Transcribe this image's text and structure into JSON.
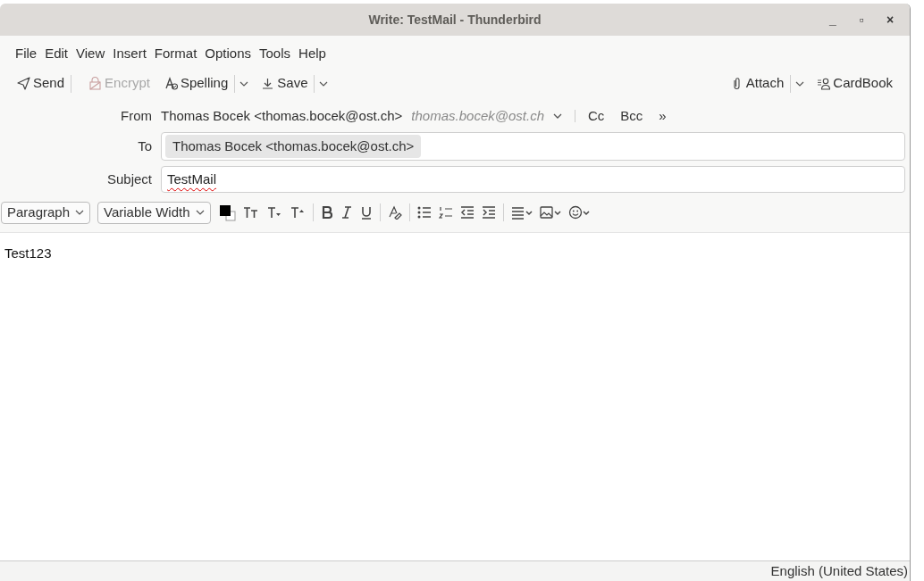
{
  "window": {
    "title": "Write: TestMail - Thunderbird",
    "controls": [
      "_",
      "▫",
      "×"
    ]
  },
  "menu": [
    {
      "label": "File"
    },
    {
      "label": "Edit"
    },
    {
      "label": "View"
    },
    {
      "label": "Insert"
    },
    {
      "label": "Format"
    },
    {
      "label": "Options"
    },
    {
      "label": "Tools"
    },
    {
      "label": "Help"
    }
  ],
  "toolbar": {
    "left": [
      {
        "kind": "send",
        "label": "Send",
        "disabled": false,
        "dropdown": false
      },
      {
        "kind": "encrypt",
        "label": "Encrypt",
        "disabled": true,
        "dropdown": false
      },
      {
        "kind": "spelling",
        "label": "Spelling",
        "disabled": false,
        "dropdown": true
      },
      {
        "kind": "save",
        "label": "Save",
        "disabled": false,
        "dropdown": true
      }
    ],
    "right": [
      {
        "kind": "attach",
        "label": "Attach",
        "disabled": false,
        "dropdown": true
      },
      {
        "kind": "cardbook",
        "label": "CardBook",
        "disabled": false,
        "dropdown": false
      }
    ]
  },
  "header": {
    "from": {
      "label": "From",
      "value": "Thomas Bocek <thomas.bocek@ost.ch>",
      "identity": "thomas.bocek@ost.ch",
      "links": [
        "Cc",
        "Bcc",
        "»"
      ]
    },
    "to": {
      "label": "To",
      "recipients": [
        "Thomas Bocek <thomas.bocek@ost.ch>"
      ]
    },
    "subject": {
      "label": "Subject",
      "value": "TestMail",
      "misspelled": true
    }
  },
  "format_toolbar": {
    "paragraph": "Paragraph",
    "font": "Variable Width"
  },
  "body": {
    "text": "Test123"
  },
  "status_bar": {
    "language": "English (United States)"
  }
}
